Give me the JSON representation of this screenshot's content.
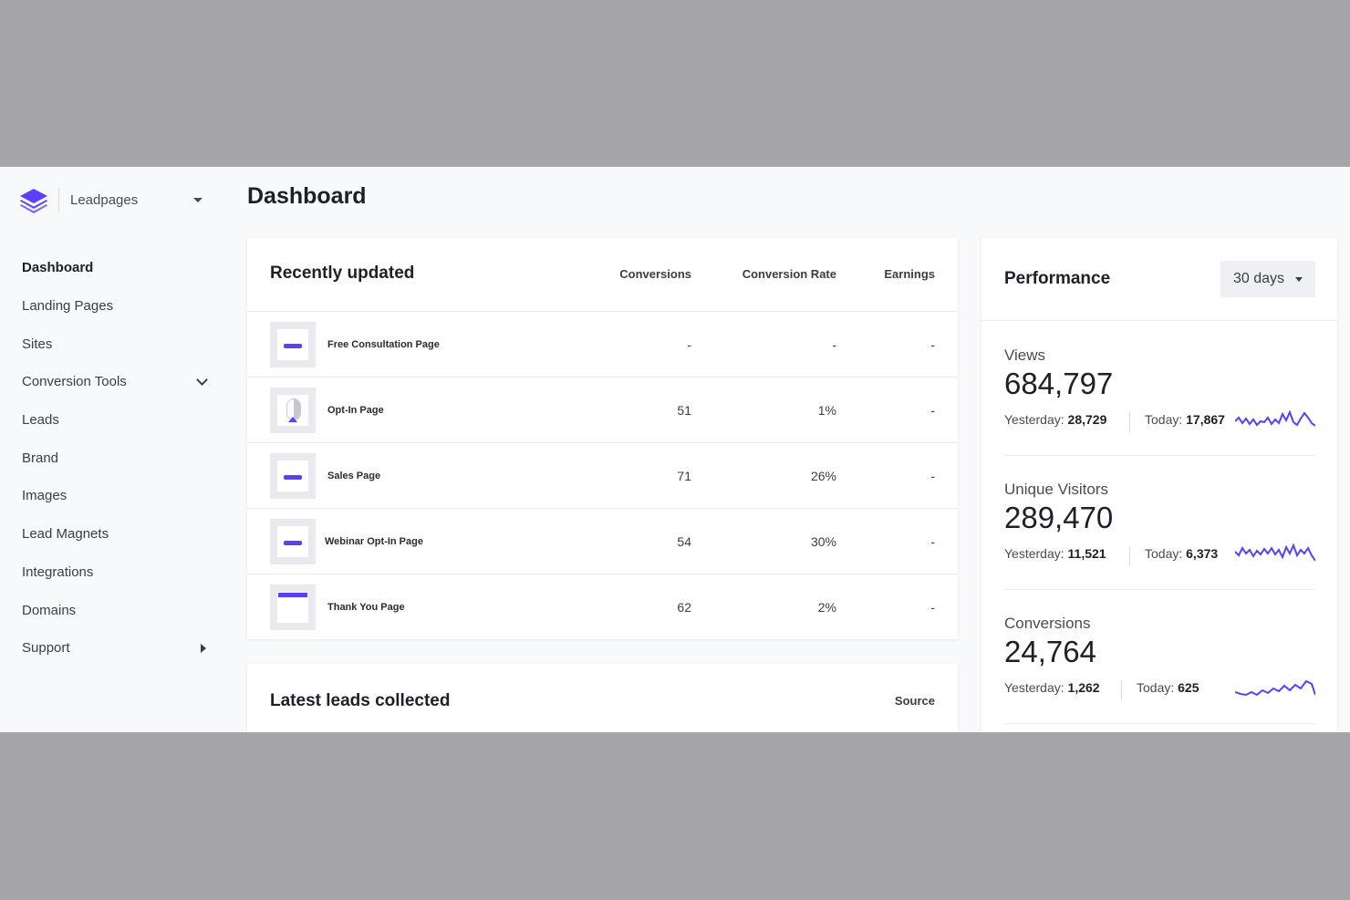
{
  "brand": {
    "name": "Leadpages"
  },
  "nav": [
    {
      "label": "Dashboard",
      "active": true
    },
    {
      "label": "Landing Pages"
    },
    {
      "label": "Sites"
    },
    {
      "label": "Conversion Tools",
      "icon": "chevron-down-icon"
    },
    {
      "label": "Leads"
    },
    {
      "label": "Brand"
    },
    {
      "label": "Images"
    },
    {
      "label": "Lead Magnets"
    },
    {
      "label": "Integrations"
    },
    {
      "label": "Domains"
    },
    {
      "label": "Support",
      "icon": "caret-right-icon"
    }
  ],
  "page": {
    "title": "Dashboard"
  },
  "recent": {
    "title": "Recently updated",
    "columns": {
      "conversions": "Conversions",
      "rate": "Conversion Rate",
      "earnings": "Earnings"
    },
    "rows": [
      {
        "name": "Free Consultation Page",
        "conversions": "-",
        "rate": "-",
        "earnings": "-"
      },
      {
        "name": "Opt-In Page",
        "conversions": "51",
        "rate": "1%",
        "earnings": "-"
      },
      {
        "name": "Sales Page",
        "conversions": "71",
        "rate": "26%",
        "earnings": "-"
      },
      {
        "name": "Webinar Opt-In Page",
        "conversions": "54",
        "rate": "30%",
        "earnings": "-"
      },
      {
        "name": "Thank You Page",
        "conversions": "62",
        "rate": "2%",
        "earnings": "-"
      }
    ]
  },
  "leads": {
    "title": "Latest leads collected",
    "source_label": "Source"
  },
  "performance": {
    "title": "Performance",
    "range": "30 days",
    "metrics": [
      {
        "label": "Views",
        "value": "684,797",
        "yesterday_label": "Yesterday:",
        "yesterday": "28,729",
        "today_label": "Today:",
        "today": "17,867"
      },
      {
        "label": "Unique Visitors",
        "value": "289,470",
        "yesterday_label": "Yesterday:",
        "yesterday": "11,521",
        "today_label": "Today:",
        "today": "6,373"
      },
      {
        "label": "Conversions",
        "value": "24,764",
        "yesterday_label": "Yesterday:",
        "yesterday": "1,262",
        "today_label": "Today:",
        "today": "625"
      }
    ]
  },
  "colors": {
    "accent": "#5a3fff",
    "background": "#f7f9fb",
    "frame": "#a6a6aa"
  }
}
